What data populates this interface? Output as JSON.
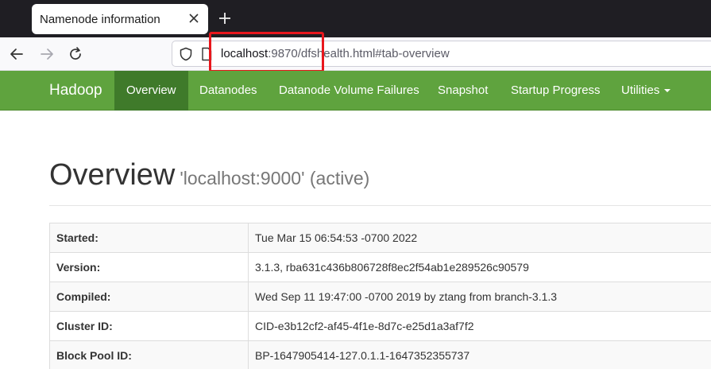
{
  "browser": {
    "tab_title": "Namenode information",
    "new_tab_symbol": "+",
    "url_host": "localhost",
    "url_rest": ":9870/dfshealth.html#tab-overview"
  },
  "navbar": {
    "brand": "Hadoop",
    "items": [
      {
        "label": "Overview",
        "active": true
      },
      {
        "label": "Datanodes"
      },
      {
        "label": "Datanode Volume Failures"
      },
      {
        "label": "Snapshot"
      },
      {
        "label": "Startup Progress"
      },
      {
        "label": "Utilities"
      }
    ]
  },
  "page": {
    "title": "Overview",
    "subtitle": "'localhost:9000' (active)"
  },
  "overview_table": [
    {
      "key": "Started:",
      "value": "Tue Mar 15 06:54:53 -0700 2022"
    },
    {
      "key": "Version:",
      "value": "3.1.3, rba631c436b806728f8ec2f54ab1e289526c90579"
    },
    {
      "key": "Compiled:",
      "value": "Wed Sep 11 19:47:00 -0700 2019 by ztang from branch-3.1.3"
    },
    {
      "key": "Cluster ID:",
      "value": "CID-e3b12cf2-af45-4f1e-8d7c-e25d1a3af7f2"
    },
    {
      "key": "Block Pool ID:",
      "value": "BP-1647905414-127.0.1.1-1647352355737"
    }
  ],
  "colors": {
    "navbar": "#5fa33e",
    "navbar_active": "#3f7a2a",
    "highlight_box": "#e8171d"
  },
  "icons": [
    "close-icon",
    "plus-icon",
    "back-arrow-icon",
    "forward-arrow-icon",
    "reload-icon",
    "shield-icon",
    "page-icon",
    "caret-down-icon"
  ]
}
